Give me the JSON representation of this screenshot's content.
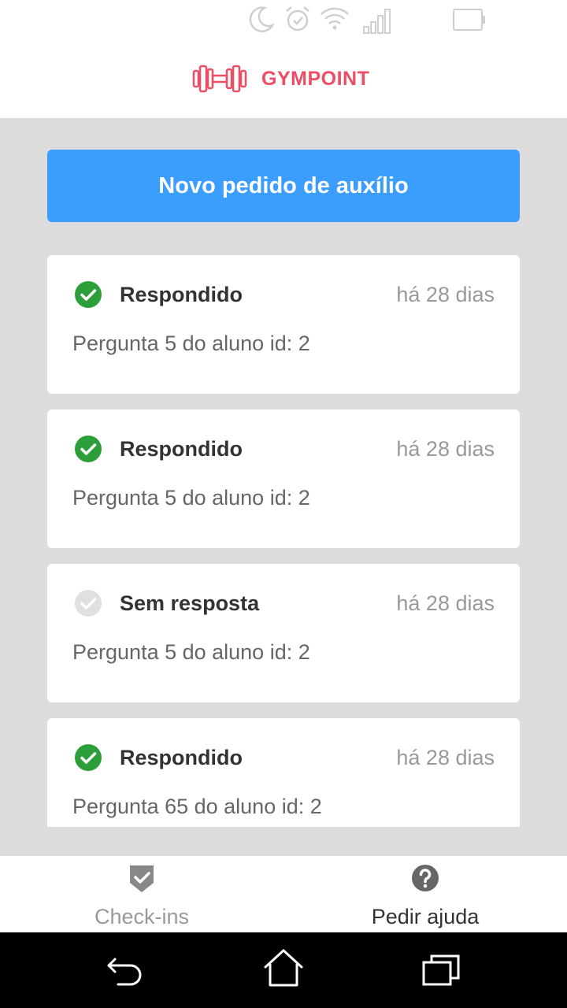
{
  "status_bar": {
    "icons": [
      "moon-icon",
      "alarm-icon",
      "wifi-icon",
      "signal-icon",
      "battery-icon"
    ]
  },
  "header": {
    "logo_icon": "dumbbell-icon",
    "logo_text": "GYMPOINT",
    "brand_color": "#ee4d64"
  },
  "main": {
    "new_request_label": "Novo pedido de auxílio",
    "button_color": "#3b9eff",
    "requests": [
      {
        "status": "Respondido",
        "answered": true,
        "time": "há 28 dias",
        "question": "Pergunta 5 do aluno id: 2"
      },
      {
        "status": "Respondido",
        "answered": true,
        "time": "há 28 dias",
        "question": "Pergunta 5 do aluno id: 2"
      },
      {
        "status": "Sem resposta",
        "answered": false,
        "time": "há 28 dias",
        "question": "Pergunta 5 do aluno id: 2"
      },
      {
        "status": "Respondido",
        "answered": true,
        "time": "há 28 dias",
        "question": "Pergunta 65 do aluno id: 2"
      }
    ]
  },
  "tab_bar": {
    "tabs": [
      {
        "label": "Check-ins",
        "icon": "shield-check-icon",
        "active": false
      },
      {
        "label": "Pedir ajuda",
        "icon": "help-circle-icon",
        "active": true
      }
    ]
  },
  "nav_bar": {
    "icons": [
      "back-icon",
      "home-icon",
      "recents-icon"
    ]
  }
}
